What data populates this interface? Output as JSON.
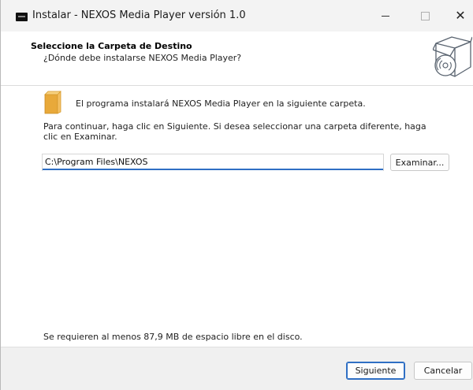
{
  "window": {
    "title": "Instalar - NEXOS Media Player versión 1.0",
    "minimize_symbol": "",
    "close_symbol": "✕"
  },
  "header": {
    "title": "Seleccione la Carpeta de Destino",
    "subtitle": "¿Dónde debe instalarse NEXOS Media Player?",
    "logo_icon": "box-disc-icon"
  },
  "main": {
    "folder_icon": "folder-icon",
    "info_text": "El programa instalará NEXOS Media Player en la siguiente carpeta.",
    "instructions": "Para continuar, haga clic en Siguiente. Si desea seleccionar una carpeta diferente, haga clic en Examinar.",
    "path_value": "C:\\Program Files\\NEXOS",
    "browse_label": "Examinar...",
    "space_text": "Se requieren al menos 87,9 MB de espacio libre en el disco."
  },
  "footer": {
    "next_label": "Siguiente",
    "cancel_label": "Cancelar"
  },
  "colors": {
    "accent": "#2f6fc4",
    "folder": "#f4c063"
  }
}
